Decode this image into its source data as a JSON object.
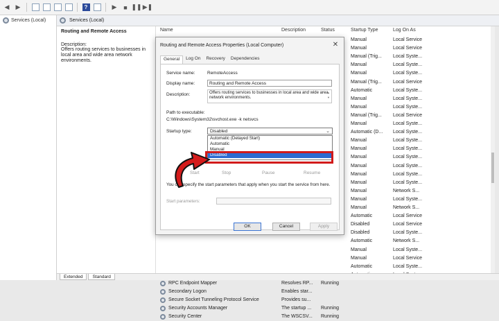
{
  "tree": {
    "root_label": "Services (Local)"
  },
  "main_header": {
    "title": "Services (Local)"
  },
  "description_pane": {
    "title": "Routing and Remote Access",
    "label": "Description:",
    "text": "Offers routing services to businesses in local area and wide area network environments."
  },
  "columns": {
    "name": "Name",
    "description": "Description",
    "status": "Status",
    "startup_type": "Startup Type",
    "log_on_as": "Log On As"
  },
  "right_rows": [
    {
      "startup": "Manual",
      "logon": "Local Service"
    },
    {
      "startup": "Manual",
      "logon": "Local Service"
    },
    {
      "startup": "Manual (Trig...",
      "logon": "Local Syste..."
    },
    {
      "startup": "Manual",
      "logon": "Local Syste..."
    },
    {
      "startup": "Manual",
      "logon": "Local Syste..."
    },
    {
      "startup": "Manual (Trig...",
      "logon": "Local Service"
    },
    {
      "startup": "Automatic",
      "logon": "Local Syste..."
    },
    {
      "startup": "Manual",
      "logon": "Local Syste..."
    },
    {
      "startup": "Manual",
      "logon": "Local Syste..."
    },
    {
      "startup": "Manual (Trig...",
      "logon": "Local Service"
    },
    {
      "startup": "Manual",
      "logon": "Local Syste..."
    },
    {
      "startup": "Automatic (D...",
      "logon": "Local Syste..."
    },
    {
      "startup": "Manual",
      "logon": "Local Syste..."
    },
    {
      "startup": "Manual",
      "logon": "Local Syste..."
    },
    {
      "startup": "Manual",
      "logon": "Local Syste..."
    },
    {
      "startup": "Manual",
      "logon": "Local Syste..."
    },
    {
      "startup": "Manual",
      "logon": "Local Syste..."
    },
    {
      "startup": "Manual",
      "logon": "Local Syste..."
    },
    {
      "startup": "Manual",
      "logon": "Network S..."
    },
    {
      "startup": "Manual",
      "logon": "Local Syste..."
    },
    {
      "startup": "Manual",
      "logon": "Network S..."
    },
    {
      "startup": "Automatic",
      "logon": "Local Service"
    },
    {
      "startup": "Disabled",
      "logon": "Local Service"
    },
    {
      "startup": "Disabled",
      "logon": "Local Syste..."
    },
    {
      "startup": "Automatic",
      "logon": "Network S..."
    },
    {
      "startup": "Manual",
      "logon": "Local Syste..."
    },
    {
      "startup": "Manual",
      "logon": "Local Service"
    },
    {
      "startup": "Automatic",
      "logon": "Local Syste..."
    },
    {
      "startup": "Automatic",
      "logon": "Local Syste..."
    }
  ],
  "full_rows": [
    {
      "name": "RPC Endpoint Mapper",
      "description": "Resolves RP...",
      "status": "Running"
    },
    {
      "name": "Secondary Logon",
      "description": "Enables star...",
      "status": ""
    },
    {
      "name": "Secure Socket Tunneling Protocol Service",
      "description": "Provides su...",
      "status": ""
    },
    {
      "name": "Security Accounts Manager",
      "description": "The startup ...",
      "status": "Running"
    },
    {
      "name": "Security Center",
      "description": "The WSCSV...",
      "status": "Running"
    }
  ],
  "dialog": {
    "title": "Routing and Remote Access Properties (Local Computer)",
    "close": "✕",
    "tabs": [
      "General",
      "Log On",
      "Recovery",
      "Dependencies"
    ],
    "service_name_label": "Service name:",
    "service_name": "RemoteAccess",
    "display_name_label": "Display name:",
    "display_name": "Routing and Remote Access",
    "description_label": "Description:",
    "description": "Offers routing services to businesses in local area and wide area network environments.",
    "path_label": "Path to executable:",
    "path": "C:\\Windows\\System32\\svchost.exe -k netsvcs",
    "startup_type_label": "Startup type:",
    "startup_value": "Disabled",
    "startup_options": [
      "Automatic (Delayed Start)",
      "Automatic",
      "Manual",
      "Disabled"
    ],
    "start_btn": "Start",
    "stop_btn": "Stop",
    "pause_btn": "Pause",
    "resume_btn": "Resume",
    "note": "You can specify the start parameters that apply when you start the service from here.",
    "params_label": "Start parameters:",
    "ok": "OK",
    "cancel": "Cancel",
    "apply": "Apply"
  },
  "bottom_tabs": [
    "Extended",
    "Standard"
  ],
  "colors": {
    "highlight": "#d11a1a",
    "selection": "#2c6bd1"
  }
}
